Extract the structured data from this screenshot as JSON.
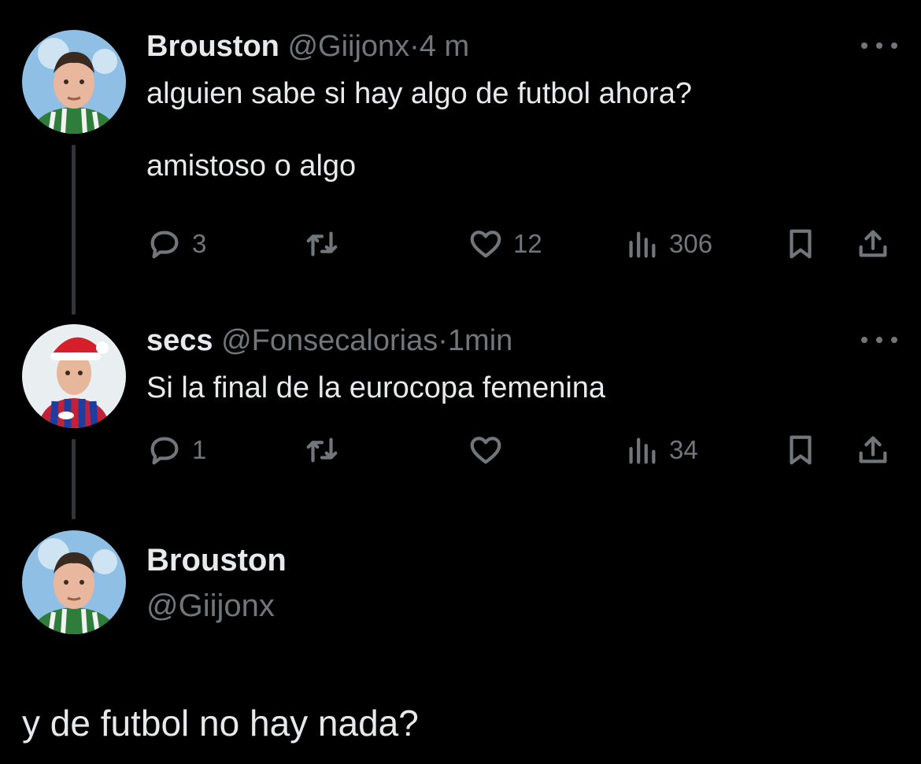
{
  "tweets": [
    {
      "name": "Brouston",
      "handle": "@Giijonx",
      "separator": "·",
      "time": "4 m",
      "text": "alguien sabe si hay algo de futbol ahora?\n\namistoso o algo",
      "replies": "3",
      "retweets": "",
      "likes": "12",
      "views": "306"
    },
    {
      "name": "secs",
      "handle": "@Fonsecalorias",
      "separator": "·",
      "time": "1min",
      "text": "Si la final de la eurocopa femenina",
      "replies": "1",
      "retweets": "",
      "likes": "",
      "views": "34"
    }
  ],
  "quote": {
    "name": "Brouston",
    "handle": "@Giijonx",
    "text": "y de futbol no hay nada?"
  },
  "icons": {
    "reply": "reply-icon",
    "retweet": "retweet-icon",
    "like": "heart-icon",
    "views": "views-icon",
    "bookmark": "bookmark-icon",
    "share": "share-icon",
    "more": "more-icon"
  },
  "colors": {
    "background": "#000000",
    "primary_text": "#e7e9ea",
    "secondary_text": "#71767b",
    "thread_line": "#333639"
  }
}
